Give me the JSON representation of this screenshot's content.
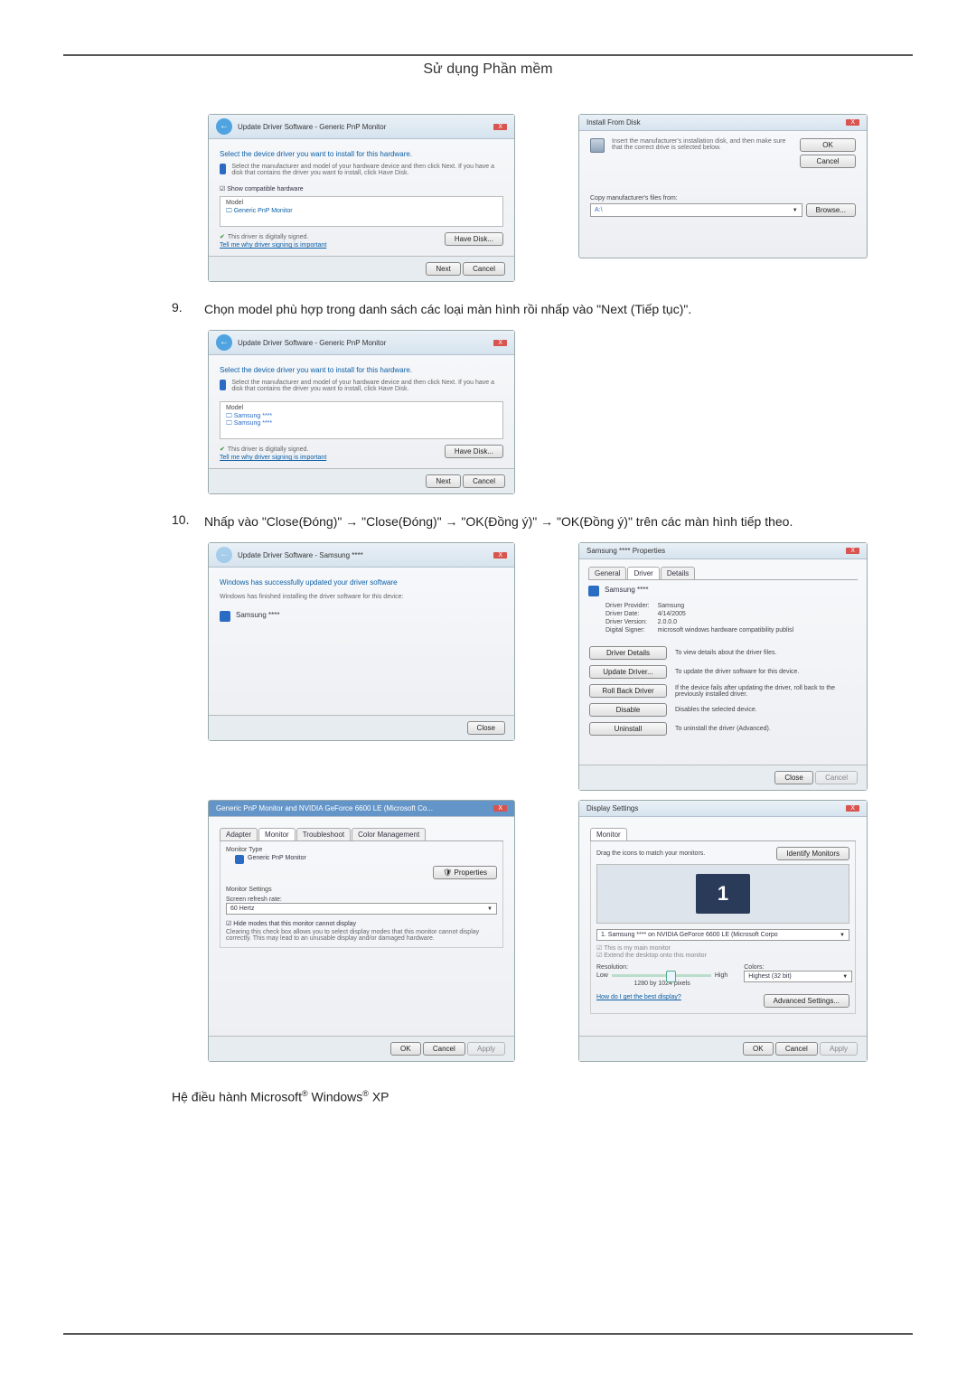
{
  "header": {
    "title": "Sử dụng Phần mềm"
  },
  "steps": {
    "s9": {
      "num": "9.",
      "text": "Chọn model phù hợp trong danh sách các loại màn hình rồi nhấp vào \"Next (Tiếp tục)\"."
    },
    "s10": {
      "num": "10.",
      "text": "Nhấp vào \"Close(Đóng)\" → \"Close(Đóng)\" → \"OK(Đồng ý)\" → \"OK(Đồng ý)\" trên các màn hình tiếp theo."
    }
  },
  "shot1": {
    "title": "Update Driver Software - Generic PnP Monitor",
    "heading": "Select the device driver you want to install for this hardware.",
    "help": "Select the manufacturer and model of your hardware device and then click Next. If you have a disk that contains the driver you want to install, click Have Disk.",
    "show_compat": "Show compatible hardware",
    "model_label": "Model",
    "model_item": "Generic PnP Monitor",
    "signed": "This driver is digitally signed.",
    "why_link": "Tell me why driver signing is important",
    "have_disk": "Have Disk...",
    "next": "Next",
    "cancel": "Cancel"
  },
  "shot2": {
    "title": "Install From Disk",
    "msg": "Insert the manufacturer's installation disk, and then make sure that the correct drive is selected below.",
    "ok": "OK",
    "cancel": "Cancel",
    "copy_label": "Copy manufacturer's files from:",
    "browse": "Browse..."
  },
  "shot3": {
    "title": "Update Driver Software - Generic PnP Monitor",
    "heading": "Select the device driver you want to install for this hardware.",
    "help": "Select the manufacturer and model of your hardware device and then click Next. If you have a disk that contains the driver you want to install, click Have Disk.",
    "model_label": "Model",
    "model_item1": "Samsung ****",
    "model_item2": "Samsung ****",
    "signed": "This driver is digitally signed.",
    "why_link": "Tell me why driver signing is important",
    "have_disk": "Have Disk...",
    "next": "Next",
    "cancel": "Cancel"
  },
  "shot4": {
    "title": "Update Driver Software - Samsung ****",
    "heading": "Windows has successfully updated your driver software",
    "sub": "Windows has finished installing the driver software for this device:",
    "device": "Samsung ****",
    "close": "Close"
  },
  "shot5": {
    "title": "Samsung **** Properties",
    "tabs": {
      "general": "General",
      "driver": "Driver",
      "details": "Details"
    },
    "device": "Samsung ****",
    "rows": {
      "provider_l": "Driver Provider:",
      "provider_v": "Samsung",
      "date_l": "Driver Date:",
      "date_v": "4/14/2005",
      "version_l": "Driver Version:",
      "version_v": "2.0.0.0",
      "signer_l": "Digital Signer:",
      "signer_v": "microsoft windows hardware compatibility publisl"
    },
    "buttons": {
      "details": "Driver Details",
      "details_d": "To view details about the driver files.",
      "update": "Update Driver...",
      "update_d": "To update the driver software for this device.",
      "rollback": "Roll Back Driver",
      "rollback_d": "If the device fails after updating the driver, roll back to the previously installed driver.",
      "disable": "Disable",
      "disable_d": "Disables the selected device.",
      "uninstall": "Uninstall",
      "uninstall_d": "To uninstall the driver (Advanced)."
    },
    "close": "Close",
    "cancel": "Cancel"
  },
  "shot6": {
    "title": "Generic PnP Monitor and NVIDIA GeForce 6600 LE (Microsoft Co...",
    "tabs": {
      "adapter": "Adapter",
      "monitor": "Monitor",
      "trouble": "Troubleshoot",
      "color": "Color Management"
    },
    "mt_label": "Monitor Type",
    "mt_value": "Generic PnP Monitor",
    "props_btn": "Properties",
    "ms_label": "Monitor Settings",
    "rate_l": "Screen refresh rate:",
    "rate_v": "60 Hertz",
    "hide_chk": "Hide modes that this monitor cannot display",
    "hide_help": "Clearing this check box allows you to select display modes that this monitor cannot display correctly. This may lead to an unusable display and/or damaged hardware.",
    "ok": "OK",
    "cancel": "Cancel",
    "apply": "Apply"
  },
  "shot7": {
    "title": "Display Settings",
    "tab": "Monitor",
    "drag": "Drag the icons to match your monitors.",
    "identify": "Identify Monitors",
    "monitor_num": "1",
    "current": "1. Samsung **** on NVIDIA GeForce 6600 LE (Microsoft Corpo",
    "main_chk": "This is my main monitor",
    "extend_chk": "Extend the desktop onto this monitor",
    "res_l": "Resolution:",
    "res_lo": "Low",
    "res_hi": "High",
    "res_v": "1280 by 1024 pixels",
    "col_l": "Colors:",
    "col_v": "Highest (32 bit)",
    "best_link": "How do I get the best display?",
    "adv": "Advanced Settings...",
    "ok": "OK",
    "cancel": "Cancel",
    "apply": "Apply"
  },
  "footer": {
    "os_text_a": "Hệ điều hành Microsoft",
    "os_text_b": " Windows",
    "os_text_c": " XP"
  }
}
